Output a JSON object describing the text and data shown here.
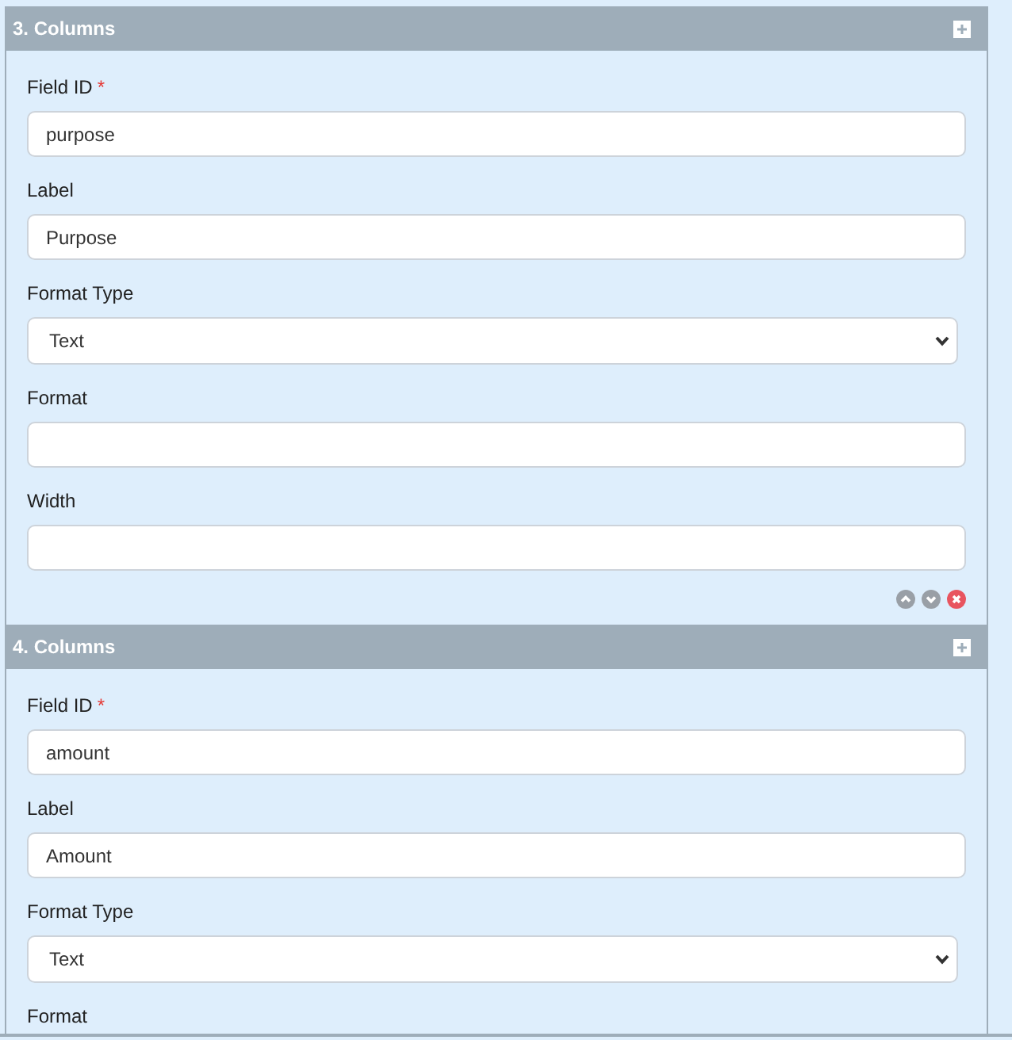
{
  "sections": [
    {
      "title": "3. Columns",
      "fields": [
        {
          "kind": "text",
          "label": "Field ID",
          "marker": "*",
          "value": "purpose"
        },
        {
          "kind": "text",
          "label": "Label",
          "value": "Purpose"
        },
        {
          "kind": "select",
          "label": "Format Type",
          "value": "Text"
        },
        {
          "kind": "text",
          "label": "Format"
        },
        {
          "kind": "text",
          "label": "Width"
        }
      ],
      "actions": true
    },
    {
      "title": "4. Columns",
      "fields": [
        {
          "kind": "text",
          "label": "Field ID",
          "marker": "*",
          "value": "amount"
        },
        {
          "kind": "text",
          "label": "Label",
          "value": "Amount"
        },
        {
          "kind": "select",
          "label": "Format Type",
          "value": "Text"
        },
        {
          "kind": "cut",
          "label": "Format"
        }
      ],
      "actions": false
    }
  ]
}
